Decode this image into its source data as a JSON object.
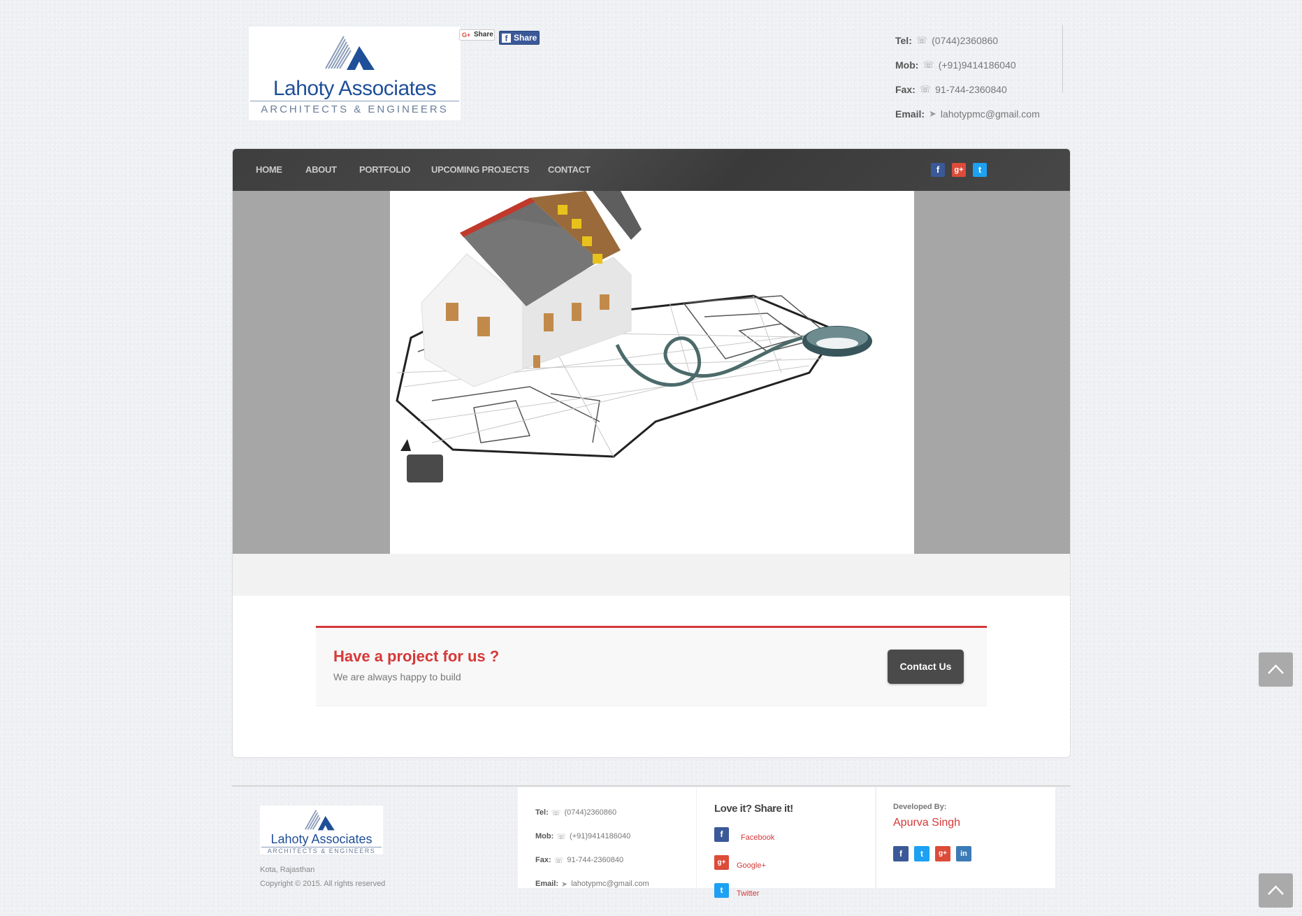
{
  "header": {
    "logo": {
      "name": "Lahoty Associates",
      "tagline": "ARCHITECTS & ENGINEERS"
    },
    "share_buttons": {
      "gplus_label": "Share",
      "facebook_label": "Share"
    },
    "contact": [
      {
        "label": "Tel:",
        "icon": "phone-icon",
        "value": "(0744)2360860"
      },
      {
        "label": "Mob:",
        "icon": "phone-icon",
        "value": "(+91)9414186040"
      },
      {
        "label": "Fax:",
        "icon": "phone-icon",
        "value": "91-744-2360840"
      },
      {
        "label": "Email:",
        "icon": "paper-plane-icon",
        "value": "lahotypmc@gmail.com"
      }
    ]
  },
  "nav": {
    "items": [
      "HOME",
      "ABOUT",
      "PORTFOLIO",
      "UPCOMING PROJECTS",
      "CONTACT"
    ],
    "social": [
      {
        "name": "facebook",
        "glyph": "f",
        "color": "#3b5998"
      },
      {
        "name": "google-plus",
        "glyph": "g+",
        "color": "#dd4b39"
      },
      {
        "name": "twitter",
        "glyph": "t",
        "color": "#1da1f2"
      }
    ]
  },
  "cta": {
    "title": "Have a project for us ?",
    "subtitle": "We are always happy to build",
    "button": "Contact Us"
  },
  "footer": {
    "logo": {
      "name": "Lahoty Associates",
      "tagline": "ARCHITECTS & ENGINEERS"
    },
    "location": "Kota, Rajasthan",
    "copyright": "Copyright © 2015. All rights reserved",
    "contact": [
      {
        "label": "Tel:",
        "value": "(0744)2360860"
      },
      {
        "label": "Mob:",
        "value": "(+91)9414186040"
      },
      {
        "label": "Fax:",
        "value": "91-744-2360840"
      },
      {
        "label": "Email:",
        "value": "lahotypmc@gmail.com"
      }
    ],
    "share_title": "Love it? Share it!",
    "share_links": [
      {
        "label": "Facebook",
        "icon": "facebook-icon"
      },
      {
        "label": "Google+",
        "icon": "google-plus-icon"
      },
      {
        "label": "Twitter",
        "icon": "twitter-icon"
      }
    ],
    "developed_by_label": "Developed By:",
    "developer_name": "Apurva Singh",
    "developer_social": [
      "facebook-icon",
      "twitter-icon",
      "google-plus-icon",
      "linkedin-icon"
    ]
  },
  "colors": {
    "accent_red": "#d63838",
    "nav_bg": "#444444",
    "brand_blue": "#1f4f98"
  }
}
